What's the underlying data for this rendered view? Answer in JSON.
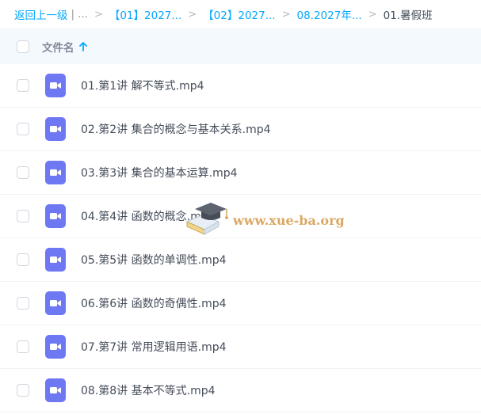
{
  "breadcrumb": {
    "back": "返回上一级",
    "divider": "|",
    "ellipsis": "...",
    "sep": ">",
    "items": [
      "【01】2027...",
      "【02】2027...",
      "08.2027年..."
    ],
    "current": "01.暑假班"
  },
  "header": {
    "column_label": "文件名"
  },
  "files": [
    "01.第1讲 解不等式.mp4",
    "02.第2讲 集合的概念与基本关系.mp4",
    "03.第3讲 集合的基本运算.mp4",
    "04.第4讲 函数的概念.mp4",
    "05.第5讲 函数的单调性.mp4",
    "06.第6讲 函数的奇偶性.mp4",
    "07.第7讲 常用逻辑用语.mp4",
    "08.第8讲 基本不等式.mp4"
  ],
  "watermark": {
    "text": "www.xue-ba.org"
  },
  "colors": {
    "link": "#06a7ff",
    "video_icon": "#6f78f3",
    "header_bg": "#f4f9fe",
    "watermark": "#d49a4a"
  },
  "icons": {
    "sort": "arrow-up-icon",
    "file": "video-icon",
    "watermark_logo": "graduation-cap-icon"
  }
}
